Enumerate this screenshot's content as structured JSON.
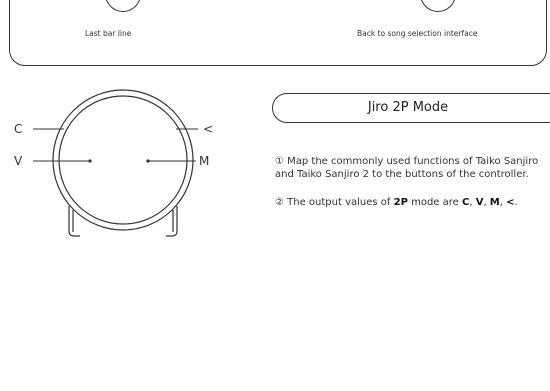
{
  "top_panel": {
    "buttons": [
      {
        "key": "end",
        "caption": "Last bar line"
      },
      {
        "key": "esc",
        "caption": "Back to song selection interface"
      }
    ]
  },
  "diagram": {
    "labels": {
      "c": "C",
      "v": "V",
      "m": "M",
      "lt": "<"
    }
  },
  "mode": {
    "title": "Jiro 2P Mode",
    "item1": "① Map the commonly used functions of Taiko Sanjiro and Taiko Sanjiro 2 to the buttons of the controller.",
    "item2": {
      "prefix": "② The output values of ",
      "mode_name": "2P",
      "middle": " mode are ",
      "v1": "C",
      "sep1": ", ",
      "v2": "V",
      "sep2": ", ",
      "v3": "M",
      "sep3": ", ",
      "v4": "<",
      "end": "."
    }
  }
}
